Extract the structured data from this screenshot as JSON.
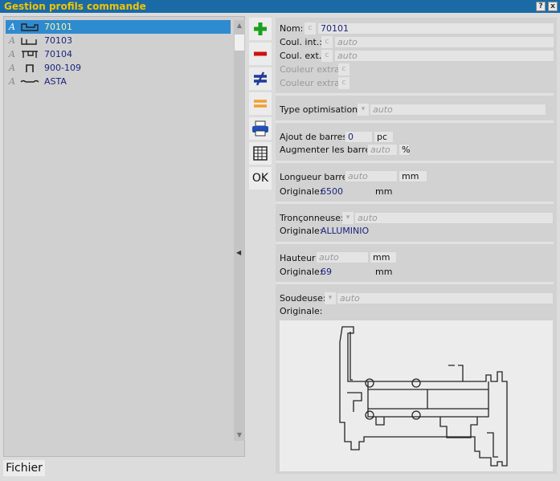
{
  "window": {
    "title": "Gestion profils commande",
    "help_btn": "?",
    "close_btn": "x"
  },
  "list": {
    "items": [
      {
        "flag": "A",
        "code": "70101",
        "selected": true
      },
      {
        "flag": "A",
        "code": "70103",
        "selected": false
      },
      {
        "flag": "A",
        "code": "70104",
        "selected": false
      },
      {
        "flag": "A",
        "code": "900-109",
        "selected": false
      },
      {
        "flag": "A",
        "code": "ASTA",
        "selected": false
      }
    ]
  },
  "toolbar": {
    "ok_label": "OK"
  },
  "form": {
    "nom_label": "Nom:",
    "nom_value": "70101",
    "coul_int_label": "Coul. int.:",
    "coul_int_value": "auto",
    "coul_ext_label": "Coul. ext.:",
    "coul_ext_value": "auto",
    "couleur_extra1_label": "Couleur extra:",
    "couleur_extra2_label": "Couleur extra:",
    "c_btn": "c",
    "type_opt_label": "Type optimisation:",
    "type_opt_value": "auto",
    "ajout_label": "Ajout de barres:",
    "ajout_value": "0",
    "ajout_unit": "pc",
    "augmenter_label": "Augmenter les barres:",
    "augmenter_value": "auto",
    "augmenter_unit": "%",
    "longueur_label": "Longueur barre:",
    "longueur_value": "auto",
    "longueur_unit": "mm",
    "longueur_orig_label": "Originale:",
    "longueur_orig_value": "6500",
    "longueur_orig_unit": "mm",
    "tronc_label": "Tronçonneuse:",
    "tronc_value": "auto",
    "tronc_orig_label": "Originale:",
    "tronc_orig_value": "ALLUMINIO",
    "hauteur_label": "Hauteur:",
    "hauteur_value": "auto",
    "hauteur_unit": "mm",
    "hauteur_orig_label": "Originale:",
    "hauteur_orig_value": "69",
    "hauteur_orig_unit": "mm",
    "soudeuse_label": "Soudeuse:",
    "soudeuse_value": "auto",
    "soudeuse_orig_label": "Originale:"
  },
  "footer": {
    "fichier_label": "Fichier"
  },
  "colors": {
    "accent": "#1a6aa6",
    "title_text": "#f2c400",
    "selection": "#2e8bd0",
    "value_text": "#1a237e"
  }
}
